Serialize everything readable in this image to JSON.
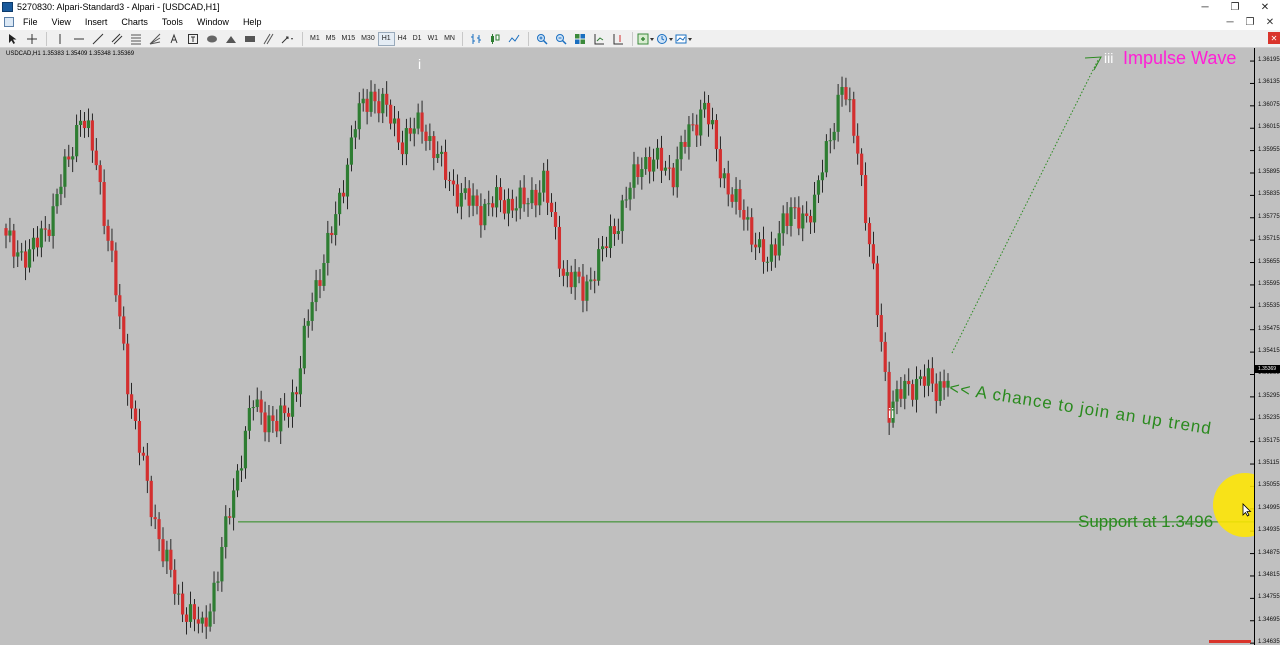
{
  "window": {
    "title": "5270830: Alpari-Standard3 - Alpari - [USDCAD,H1]",
    "controls": [
      "─",
      "❐",
      "✕"
    ]
  },
  "menu": {
    "items": [
      "File",
      "View",
      "Insert",
      "Charts",
      "Tools",
      "Window",
      "Help"
    ],
    "mdi_controls": [
      "─",
      "❐",
      "✕"
    ]
  },
  "toolbar": {
    "timeframes": [
      "M1",
      "M5",
      "M15",
      "M30",
      "H1",
      "H4",
      "D1",
      "W1",
      "MN"
    ],
    "active_timeframe": "H1",
    "close_label": "✕"
  },
  "chart": {
    "symbol_info": "USDCAD,H1  1.35383 1.35409 1.35348 1.35369",
    "price_labels": [
      "1.36195",
      "1.36135",
      "1.36075",
      "1.36015",
      "1.35955",
      "1.35895",
      "1.35835",
      "1.35775",
      "1.35715",
      "1.35655",
      "1.35595",
      "1.35535",
      "1.35475",
      "1.35415",
      "1.35355",
      "1.35295",
      "1.35235",
      "1.35175",
      "1.35115",
      "1.35055",
      "1.34995",
      "1.34935",
      "1.34875",
      "1.34815",
      "1.34755",
      "1.34695",
      "1.34635"
    ],
    "current_price": "1.35369",
    "wave_labels": {
      "i": "i",
      "ii": "ii",
      "iii": "iii"
    },
    "impulse_label": "Impulse Wave",
    "chance_label": "<< A chance to join an up trend",
    "support_label": "Support at 1.3496",
    "colors": {
      "background": "#c0c0c0",
      "bull_candle": "#2e7d32",
      "bear_candle": "#d32f2f",
      "wick": "#000000",
      "support_line": "#2a8a1e",
      "impulse_text": "#ff1fd6",
      "annotation_text": "#2a8a1e",
      "highlight": "#ffe600"
    }
  },
  "chart_data": {
    "type": "candlestick",
    "symbol": "USDCAD",
    "timeframe": "H1",
    "ylim": [
      1.3463,
      1.3623
    ],
    "support_level": 1.3496,
    "anchors": [
      [
        0,
        1.3571
      ],
      [
        6,
        1.3567
      ],
      [
        12,
        1.3579
      ],
      [
        19,
        1.3605
      ],
      [
        23,
        1.3593
      ],
      [
        27,
        1.3565
      ],
      [
        32,
        1.3527
      ],
      [
        36,
        1.3505
      ],
      [
        40,
        1.3488
      ],
      [
        44,
        1.3475
      ],
      [
        50,
        1.3467
      ],
      [
        54,
        1.3482
      ],
      [
        58,
        1.3505
      ],
      [
        63,
        1.3528
      ],
      [
        69,
        1.3521
      ],
      [
        74,
        1.3532
      ],
      [
        78,
        1.3556
      ],
      [
        84,
        1.3577
      ],
      [
        89,
        1.3603
      ],
      [
        93,
        1.3611
      ],
      [
        97,
        1.3606
      ],
      [
        101,
        1.3598
      ],
      [
        106,
        1.3603
      ],
      [
        111,
        1.3591
      ],
      [
        116,
        1.3583
      ],
      [
        121,
        1.358
      ],
      [
        126,
        1.3582
      ],
      [
        132,
        1.3581
      ],
      [
        137,
        1.3587
      ],
      [
        142,
        1.3563
      ],
      [
        147,
        1.3558
      ],
      [
        152,
        1.3568
      ],
      [
        157,
        1.358
      ],
      [
        162,
        1.3593
      ],
      [
        166,
        1.3592
      ],
      [
        170,
        1.359
      ],
      [
        174,
        1.36
      ],
      [
        178,
        1.3608
      ],
      [
        182,
        1.3591
      ],
      [
        186,
        1.3581
      ],
      [
        190,
        1.3574
      ],
      [
        194,
        1.3564
      ],
      [
        198,
        1.3578
      ],
      [
        202,
        1.3577
      ],
      [
        206,
        1.3581
      ],
      [
        210,
        1.36
      ],
      [
        213,
        1.3613
      ],
      [
        217,
        1.3597
      ],
      [
        221,
        1.3561
      ],
      [
        225,
        1.3527
      ],
      [
        229,
        1.3531
      ],
      [
        233,
        1.3535
      ],
      [
        237,
        1.3531
      ],
      [
        240,
        1.3536
      ]
    ]
  }
}
